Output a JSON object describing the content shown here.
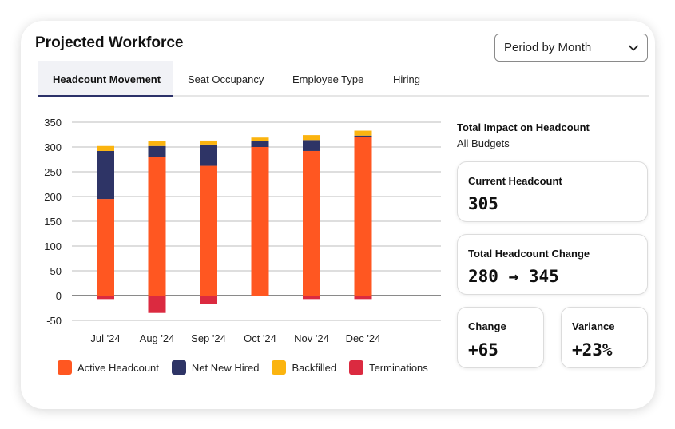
{
  "title": "Projected Workforce",
  "period_select": {
    "value": "Period by Month"
  },
  "tabs": [
    {
      "label": "Headcount Movement",
      "active": true
    },
    {
      "label": "Seat Occupancy",
      "active": false
    },
    {
      "label": "Employee Type",
      "active": false
    },
    {
      "label": "Hiring",
      "active": false
    }
  ],
  "colors": {
    "active_headcount": "#ff5721",
    "net_new_hired": "#2e3466",
    "backfilled": "#fbb40f",
    "terminations": "#db2a40",
    "tab_indicator": "#2c3169"
  },
  "chart_data": {
    "type": "bar",
    "stacked": true,
    "categories": [
      "Jul '24",
      "Aug '24",
      "Sep '24",
      "Oct '24",
      "Nov '24",
      "Dec '24"
    ],
    "series": [
      {
        "name": "Active Headcount",
        "values": [
          195,
          280,
          262,
          300,
          292,
          320
        ]
      },
      {
        "name": "Net New Hired",
        "values": [
          97,
          22,
          43,
          12,
          22,
          3
        ]
      },
      {
        "name": "Backfilled",
        "values": [
          10,
          10,
          8,
          7,
          10,
          10
        ]
      },
      {
        "name": "Terminations",
        "values": [
          -7,
          -35,
          -17,
          0,
          -7,
          -7
        ]
      }
    ],
    "yticks": [
      "350",
      "300",
      "250",
      "200",
      "150",
      "100",
      "50",
      "0",
      "-50"
    ],
    "ylim": [
      -50,
      350
    ],
    "grid": true,
    "legend_position": "bottom"
  },
  "impact": {
    "title": "Total Impact on Headcount",
    "subtitle": "All Budgets",
    "current": {
      "label": "Current Headcount",
      "value": "305"
    },
    "change_total": {
      "label": "Total Headcount Change",
      "value": "280 → 345"
    },
    "change": {
      "label": "Change",
      "value": "+65"
    },
    "variance": {
      "label": "Variance",
      "value": "+23%"
    }
  }
}
